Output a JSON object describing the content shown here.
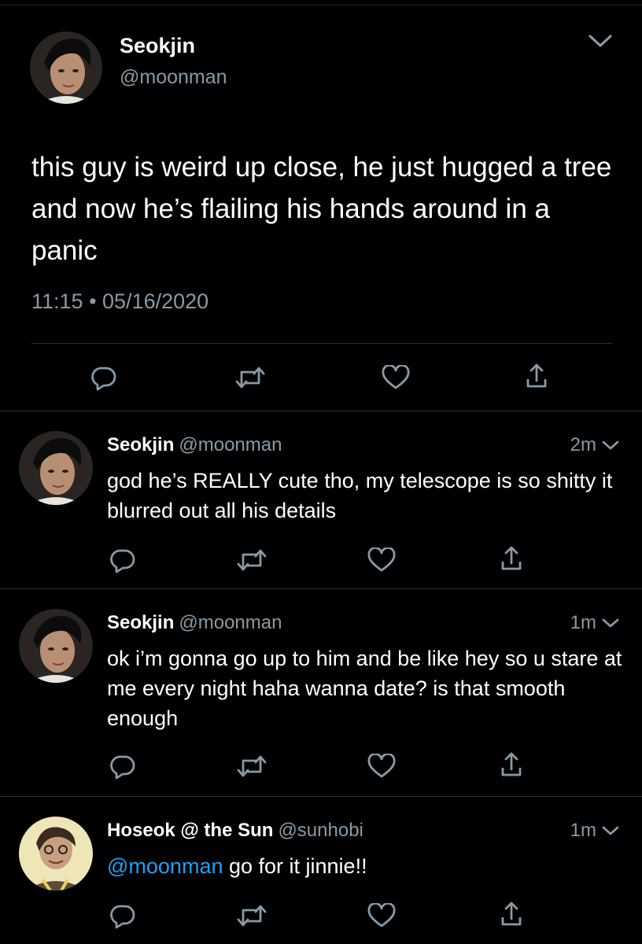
{
  "main_tweet": {
    "display_name": "Seokjin",
    "handle": "@moonman",
    "text": "this guy is weird up close, he just hugged a tree and now he’s flailing his hands around in a panic",
    "timestamp": "11:15 • 05/16/2020",
    "menu_icon": "chevron-down-icon",
    "actions": [
      "reply-icon",
      "retweet-icon",
      "like-icon",
      "share-icon"
    ]
  },
  "replies": [
    {
      "display_name": "Seokjin",
      "handle": "@moonman",
      "time": "2m",
      "text": "god he’s REALLY cute tho, my telescope is so shitty it blurred out all his details"
    },
    {
      "display_name": "Seokjin",
      "handle": "@moonman",
      "time": "1m",
      "text": "ok i’m gonna go up to him and be like hey so u stare at me every night haha wanna date? is that smooth enough"
    },
    {
      "display_name": "Hoseok @ the Sun",
      "handle": "@sunhobi",
      "time": "1m",
      "mention": "@moonman",
      "text": " go for it jinnie!!"
    }
  ],
  "colors": {
    "background": "#000000",
    "text": "#ffffff",
    "secondary": "#8899a6",
    "link": "#1da1f2",
    "divider": "#2b3036"
  }
}
